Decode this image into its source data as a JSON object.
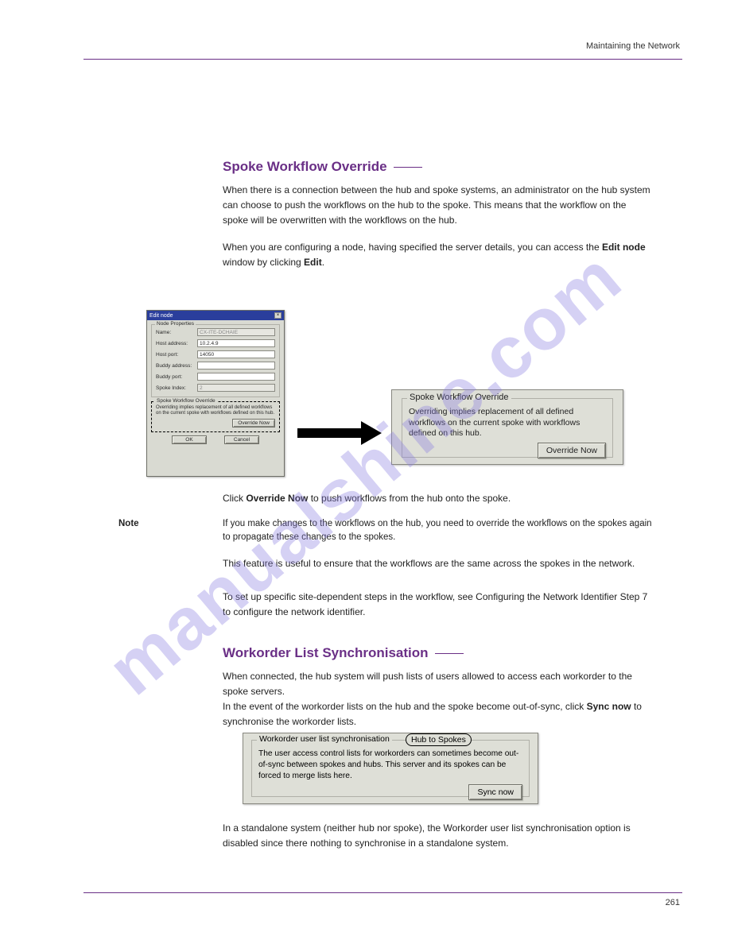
{
  "header": {
    "section_label": "Maintaining the Network"
  },
  "watermark": "manualshine.com",
  "section1": {
    "title": "Spoke Workflow Override",
    "p1_a": "When there is a connection between the hub and spoke systems, an administrator on the hub system can choose to push the workflows on the hub to the spoke. This means that the workflow on the spoke will be overwritten with the workflows on the hub.",
    "p1_b_prefix": "When you are configuring a node, having specified the server details, you can access the ",
    "p1_b_bold": "Edit node",
    "p1_b_suffix": " window by clicking ",
    "p1_b_bold2": "Edit",
    "p1_b_end": ".",
    "edit_node": {
      "title": "Edit node",
      "group_props": "Node Properties",
      "labels": {
        "name": "Name:",
        "host_address": "Host address:",
        "host_port": "Host port:",
        "buddy_address": "Buddy address:",
        "buddy_port": "Buddy port:",
        "spoke_index": "Spoke Index:"
      },
      "values": {
        "name": "CX-ITE-DCHAIE",
        "host_address": "10.2.4.9",
        "host_port": "14050",
        "buddy_address": "",
        "buddy_port": "",
        "spoke_index": "2"
      },
      "override_title": "Spoke Workflow Override",
      "override_text": "Overriding implies replacement of all defined workflows on the current spoke with workflows defined on this hub.",
      "override_btn": "Override Now",
      "ok": "OK",
      "cancel": "Cancel"
    },
    "spoke_panel": {
      "title": "Spoke Workflow Override",
      "desc": "Overriding implies replacement of all defined workflows on the current spoke with workflows defined on this hub.",
      "btn": "Override Now"
    },
    "click_line_prefix": "Click ",
    "click_line_bold": "Override Now",
    "click_line_suffix": " to push workflows from the hub onto the spoke.",
    "note_label": "Note",
    "note_text": "If you make changes to the workflows on the hub, you need to override the workflows on the spokes again to propagate these changes to the spokes.",
    "tail_a": "This feature is useful to ensure that the workflows are the same across the spokes in the network.",
    "tail_b": "To set up specific site-dependent steps in the workflow, see Configuring the Network Identifier Step 7 to configure the network identifier."
  },
  "section2": {
    "title": "Workorder List Synchronisation",
    "p1": "When connected, the hub system will push lists of users allowed to access each workorder to the spoke servers.",
    "p2_prefix": "In the event of the workorder lists on the hub and the spoke become out-of-sync, click ",
    "p2_bold": "Sync now",
    "p2_suffix": " to synchronise the workorder lists.",
    "panel": {
      "title": "Workorder user list synchronisation",
      "badge": "Hub to Spokes",
      "desc": "The user access control lists for workorders can sometimes become out-of-sync between spokes and hubs. This server and its spokes can be forced to merge lists here.",
      "btn": "Sync now"
    },
    "p3": "In a standalone system (neither hub nor spoke), the Workorder user list synchronisation option is disabled since there nothing to synchronise in a standalone system."
  },
  "footer": {
    "page": "261"
  }
}
